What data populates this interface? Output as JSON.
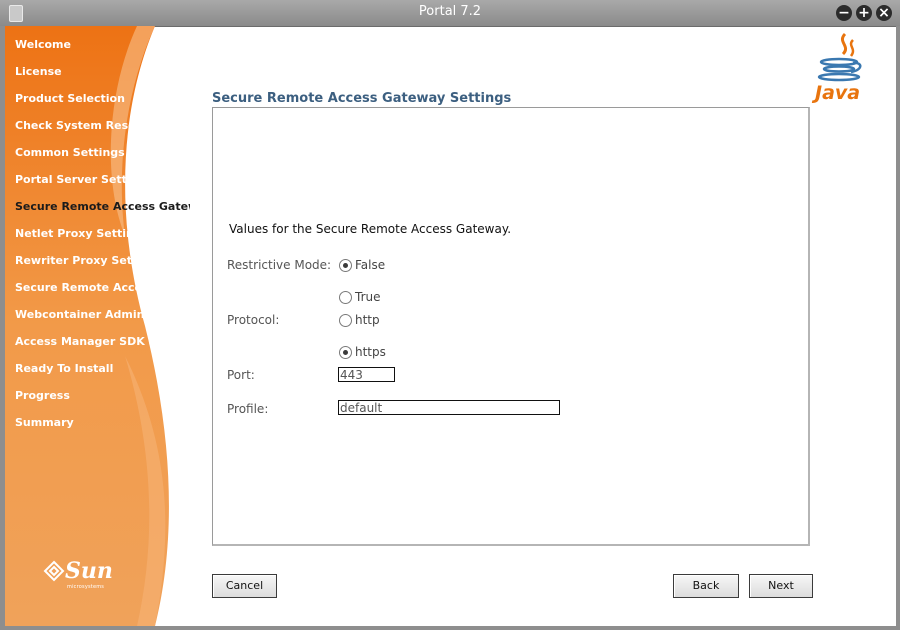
{
  "window": {
    "title": "Portal 7.2",
    "controls": [
      {
        "name": "minimize-icon",
        "glyph": "−"
      },
      {
        "name": "maximize-icon",
        "glyph": "+"
      },
      {
        "name": "close-icon",
        "glyph": "×"
      }
    ]
  },
  "sidebar": {
    "items": [
      {
        "label": "Welcome"
      },
      {
        "label": "License"
      },
      {
        "label": "Product Selection"
      },
      {
        "label": "Check System Resources"
      },
      {
        "label": "Common Settings"
      },
      {
        "label": "Portal Server Settings"
      },
      {
        "label": "Secure Remote Access Gatewa",
        "active": true
      },
      {
        "label": "Netlet Proxy Settings"
      },
      {
        "label": "Rewriter Proxy Settings"
      },
      {
        "label": "Secure Remote Access C"
      },
      {
        "label": "Webcontainer Administrati"
      },
      {
        "label": "Access Manager SDK Settin"
      },
      {
        "label": "Ready To Install"
      },
      {
        "label": "Progress"
      },
      {
        "label": "Summary"
      }
    ],
    "brand_logo": {
      "word": "Sun",
      "subtext": "microsystems"
    }
  },
  "java_logo": {
    "word": "Java"
  },
  "colors": {
    "sidebar_orange": "#ee7a1c",
    "heading": "#3c5f80",
    "java_orange": "#e8740e"
  },
  "main": {
    "heading": "Secure Remote Access Gateway Settings",
    "description": "Values for the Secure Remote Access Gateway.",
    "restrictive_mode": {
      "label": "Restrictive Mode:",
      "options": [
        {
          "label": "False",
          "selected": true
        },
        {
          "label": "True",
          "selected": false
        }
      ]
    },
    "protocol": {
      "label": "Protocol:",
      "options": [
        {
          "label": "http",
          "selected": false
        },
        {
          "label": "https",
          "selected": true
        }
      ]
    },
    "port": {
      "label": "Port:",
      "value": "443"
    },
    "profile": {
      "label": "Profile:",
      "value": "default"
    }
  },
  "buttons": {
    "cancel": "Cancel",
    "back": "Back",
    "next": "Next"
  }
}
